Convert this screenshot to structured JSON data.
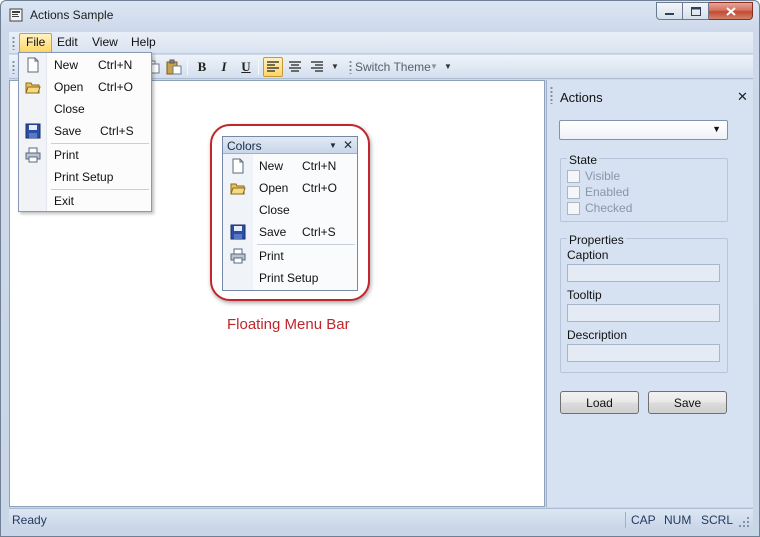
{
  "window": {
    "title": "Actions Sample"
  },
  "menubar": {
    "items": [
      "File",
      "Edit",
      "View",
      "Help"
    ]
  },
  "toolbar": {
    "bold": "B",
    "italic": "I",
    "underline": "U",
    "switch_theme": "Switch Theme"
  },
  "file_menu": {
    "items": [
      {
        "label": "New",
        "shortcut": "Ctrl+N",
        "icon": "new-document-icon"
      },
      {
        "label": "Open",
        "shortcut": "Ctrl+O",
        "icon": "open-folder-icon"
      },
      {
        "label": "Close",
        "shortcut": "",
        "icon": ""
      },
      {
        "label": "Save",
        "shortcut": "Ctrl+S",
        "icon": "save-disk-icon"
      },
      {
        "label": "Print",
        "shortcut": "",
        "icon": "printer-icon"
      },
      {
        "label": "Print Setup",
        "shortcut": "",
        "icon": ""
      },
      {
        "label": "Exit",
        "shortcut": "",
        "icon": ""
      }
    ]
  },
  "floating_menu": {
    "title": "Colors",
    "caption": "Floating Menu Bar",
    "items": [
      {
        "label": "New",
        "shortcut": "Ctrl+N",
        "icon": "new-document-icon"
      },
      {
        "label": "Open",
        "shortcut": "Ctrl+O",
        "icon": "open-folder-icon"
      },
      {
        "label": "Close",
        "shortcut": "",
        "icon": ""
      },
      {
        "label": "Save",
        "shortcut": "Ctrl+S",
        "icon": "save-disk-icon"
      },
      {
        "label": "Print",
        "shortcut": "",
        "icon": "printer-icon"
      },
      {
        "label": "Print Setup",
        "shortcut": "",
        "icon": ""
      }
    ]
  },
  "actions_pane": {
    "title": "Actions",
    "combo_value": "",
    "state": {
      "legend": "State",
      "options": [
        "Visible",
        "Enabled",
        "Checked"
      ]
    },
    "properties": {
      "legend": "Properties",
      "caption_label": "Caption",
      "tooltip_label": "Tooltip",
      "description_label": "Description"
    },
    "load_label": "Load",
    "save_label": "Save"
  },
  "statusbar": {
    "text": "Ready",
    "indicators": [
      "CAP",
      "NUM",
      "SCRL"
    ]
  },
  "colors": {
    "accent_highlight": "#ffd762",
    "callout_red": "#c0262c",
    "pane_background": "#d6e2f2"
  }
}
